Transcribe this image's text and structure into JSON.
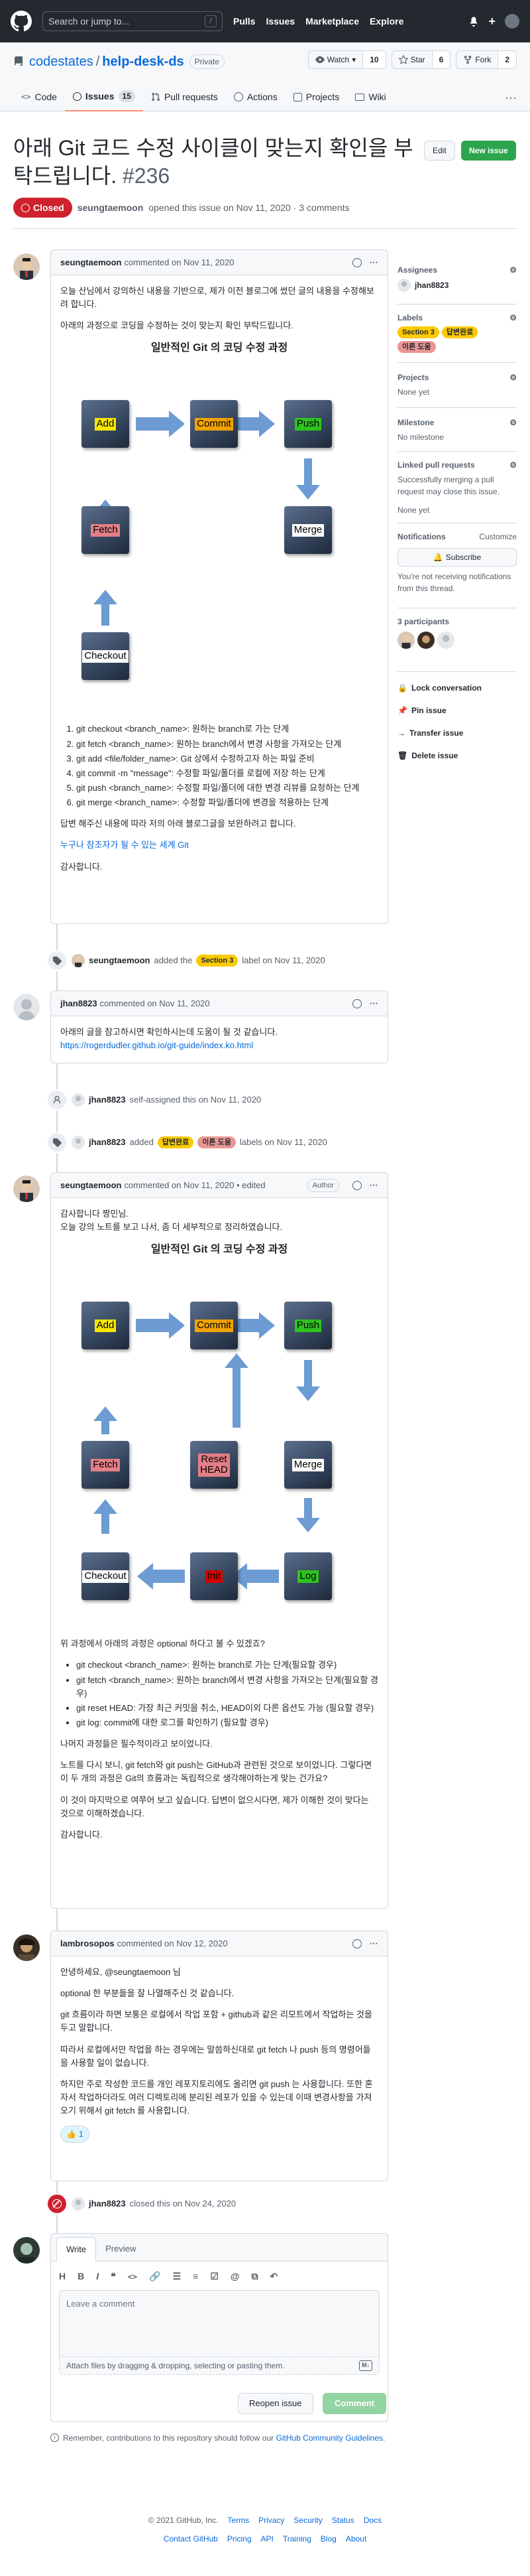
{
  "header": {
    "search_placeholder": "Search or jump to...",
    "search_key": "/",
    "nav": [
      "Pulls",
      "Issues",
      "Marketplace",
      "Explore"
    ],
    "plus": "+"
  },
  "repo": {
    "owner": "codestates",
    "separator": "/",
    "name": "help-desk-ds",
    "visibility": "Private",
    "watch_label": "Watch",
    "watch_count": "10",
    "star_label": "Star",
    "star_count": "6",
    "fork_label": "Fork",
    "fork_count": "2",
    "tabs": [
      {
        "label": "Code"
      },
      {
        "label": "Issues",
        "count": "15"
      },
      {
        "label": "Pull requests"
      },
      {
        "label": "Actions"
      },
      {
        "label": "Projects"
      },
      {
        "label": "Wiki"
      }
    ],
    "more": "···"
  },
  "issue": {
    "title": "아래 Git 코드 수정 사이클이 맞는지 확인을 부탁드립니다.",
    "number": "#236",
    "edit_label": "Edit",
    "new_issue_label": "New issue",
    "state": "Closed",
    "author": "seungtaemoon",
    "opened_text": "opened this issue on Nov 11, 2020 · 3 comments"
  },
  "comment1": {
    "author": "seungtaemoon",
    "date": "commented on Nov 11, 2020",
    "intro": "오늘 산님에서 강의하신 내용을 기반으로, 제가 이전 블로그에 썼던 글의 내용을 수정해보려 합니다.",
    "sub": "아래의 과정으로 코딩을 수정하는 것이 맞는지 확인 부탁드립니다.",
    "steps": [
      "git checkout <branch_name>: 원하는 branch로 가는 단계",
      "git fetch <branch_name>: 원하는 branch에서 변경 사항을 가져오는 단계",
      "git add <file/folder_name>: Git 상에서 수정하고자 하는 파일 준비",
      "git commit -m \"message\": 수정할 파일/폴더를 로컬에 저장 하는 단계",
      "git push <branch_name>: 수정할 파일/폴더에 대한 변경 리뷰를 요청하는 단계",
      "git merge <branch_name>: 수정할 파일/폴더에 변경을 적용하는 단계"
    ],
    "outro": "답변 해주신 내용에 따라 저의 아래 블로그글을 보완하려고 합니다.",
    "link_text": "누구나 참조자가 될 수 있는 세계 Git",
    "thanks": "감사합니다."
  },
  "diagram1": {
    "title": "일반적인  Git 의 코딩 수정 과정",
    "nodes": {
      "add": "Add",
      "commit": "Commit",
      "push": "Push",
      "fetch": "Fetch",
      "merge": "Merge",
      "checkout": "Checkout"
    }
  },
  "event1": {
    "user": "seungtaemoon",
    "action": "added the",
    "label": "Section 3",
    "suffix": "label on Nov 11, 2020"
  },
  "comment2": {
    "author": "jhan8823",
    "date": "commented on Nov 11, 2020",
    "line1": "아래의 글을 참고하시면 확인하시는데 도움이 될 것 같습니다.",
    "link": "https://rogerdudler.github.io/git-guide/index.ko.html"
  },
  "event2": {
    "user": "jhan8823",
    "action": "self-assigned this on Nov 11, 2020"
  },
  "event3": {
    "user": "jhan8823",
    "action": "added",
    "label1": "답변완료",
    "label2": "이론 도움",
    "suffix": "labels on Nov 11, 2020"
  },
  "comment3": {
    "author": "seungtaemoon",
    "date": "commented on Nov 11, 2020 • edited",
    "badge": "Author",
    "line1": "감사합니다 짱민님.",
    "line2": "오늘 강의 노트를 보고 나서, 좀 더 세부적으로 정리하였습니다.",
    "question": "위 과정에서 아래의 과정은 optional 하다고 볼 수 있겠죠?",
    "bullets": [
      "git checkout <branch_name>: 원하는 branch로 가는 단계(필요할 경우)",
      "git fetch <branch_name>: 원하는 branch에서 변경 사항을 가져오는 단계(필요할 경우)",
      "git reset HEAD: 가장 최근 커밋을 취소, HEAD이외 다른 옵션도 가능 (필요할 경우)",
      "git log: commit에 대한 로그를 확인하기 (필요할 경우)"
    ],
    "p1": "나머지 과정들은 필수적이라고 보이었니다.",
    "p2": "노트를 다시 보니, git fetch와 git push는 GitHub과 관련된 것으로 보이었니다. 그렇다면 이 두 개의 과정은 Git의 흐름과는 독립적으로 생각해야하는게 맞는 건가요?",
    "p3": "이 것이 마지막으로 여쭈어 보고 싶습니다. 답변이 없으시다면, 제가 이해한 것이 맞다는 것으로 이해하겠습니다.",
    "thanks": "감사합니다."
  },
  "diagram2": {
    "title": "일반적인  Git 의 코딩 수정 과정",
    "nodes": {
      "add": "Add",
      "commit": "Commit",
      "push": "Push",
      "fetch": "Fetch",
      "reset": "Reset\nHEAD",
      "merge": "Merge",
      "checkout": "Checkout",
      "init": "Init",
      "log": "Log"
    }
  },
  "comment4": {
    "author": "lambrosopos",
    "date": "commented on Nov 12, 2020",
    "greet": "안녕하세요, @seungtaemoon 님",
    "p1": "optional 한 부분들을 잘 나열해주신 것 같습니다.",
    "p2": "git 흐름이라 하면 보통은 로컬에서 작업 포함 + github과 같은 리모트에서 작업하는 것을 두고 말합니다.",
    "p3": "따라서 로컬에서만 작업을 하는 경우에는 말씀하신대로 git fetch 나 push 등의 명령어들을 사용할 일이 없습니다.",
    "p4": "하지만 주로 작성한 코드를 개인 레포지토리에도 올리면 git push 는 사용합니다. 또한 혼자서 작업하더라도 여러 디렉토리에 분리된 레포가 있을 수 있는데 이때 변경사항을 가져오기 위해서 git fetch 를 사용합니다.",
    "reaction_emoji": "👍",
    "reaction_count": "1"
  },
  "event4": {
    "user": "jhan8823",
    "action": "closed this on Nov 24, 2020"
  },
  "composer": {
    "write_tab": "Write",
    "preview_tab": "Preview",
    "placeholder": "Leave a comment",
    "attach": "Attach files by dragging & dropping, selecting or pasting them.",
    "reopen": "Reopen issue",
    "comment": "Comment",
    "guide_prefix": "Remember, contributions to this repository should follow our",
    "guide_link": "GitHub Community Guidelines",
    "guide_suffix": "."
  },
  "sidebar": {
    "assignees_title": "Assignees",
    "assignee": "jhan8823",
    "labels_title": "Labels",
    "labels": [
      "Section 3",
      "답변완료",
      "이론 도움"
    ],
    "projects_title": "Projects",
    "projects_val": "None yet",
    "milestone_title": "Milestone",
    "milestone_val": "No milestone",
    "linked_title": "Linked pull requests",
    "linked_desc": "Successfully merging a pull request may close this issue.",
    "linked_val": "None yet",
    "notif_title": "Notifications",
    "notif_customize": "Customize",
    "subscribe": "Subscribe",
    "notif_desc": "You're not receiving notifications from this thread.",
    "participants": "3 participants",
    "lock": "Lock conversation",
    "pin": "Pin issue",
    "transfer": "Transfer issue",
    "delete": "Delete issue"
  },
  "footer": {
    "copyright": "© 2021 GitHub, Inc.",
    "row1": [
      "Terms",
      "Privacy",
      "Security",
      "Status",
      "Docs"
    ],
    "row2": [
      "Contact GitHub",
      "Pricing",
      "API",
      "Training",
      "Blog",
      "About"
    ]
  },
  "colors": {
    "closed": "#cf222e",
    "accent": "#0969da",
    "success": "#2da44e"
  }
}
